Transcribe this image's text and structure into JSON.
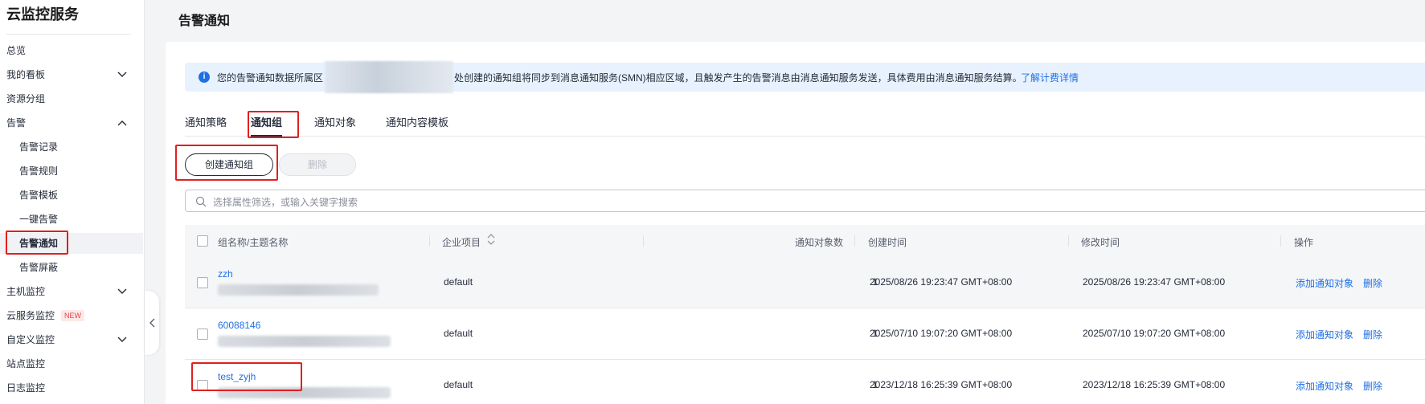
{
  "sidebar": {
    "title": "云监控服务",
    "items": [
      {
        "label": "总览",
        "level": 1,
        "chevron": ""
      },
      {
        "label": "我的看板",
        "level": 1,
        "chevron": "chevron-down-icon"
      },
      {
        "label": "资源分组",
        "level": 1,
        "chevron": ""
      },
      {
        "label": "告警",
        "level": 1,
        "chevron": "chevron-up-icon"
      },
      {
        "label": "告警记录",
        "level": 2,
        "chevron": ""
      },
      {
        "label": "告警规则",
        "level": 2,
        "chevron": ""
      },
      {
        "label": "告警模板",
        "level": 2,
        "chevron": ""
      },
      {
        "label": "一键告警",
        "level": 2,
        "chevron": ""
      },
      {
        "label": "告警通知",
        "level": 2,
        "chevron": "",
        "active": true
      },
      {
        "label": "告警屏蔽",
        "level": 2,
        "chevron": ""
      },
      {
        "label": "主机监控",
        "level": 1,
        "chevron": "chevron-down-icon"
      },
      {
        "label": "云服务监控",
        "level": 1,
        "chevron": "",
        "badge": "NEW"
      },
      {
        "label": "自定义监控",
        "level": 1,
        "chevron": "chevron-down-icon"
      },
      {
        "label": "站点监控",
        "level": 1,
        "chevron": ""
      },
      {
        "label": "日志监控",
        "level": 1,
        "chevron": ""
      }
    ]
  },
  "page": {
    "title": "告警通知"
  },
  "notice": {
    "text_before": "您的告警通知数据所属区",
    "text_after": "处创建的通知组将同步到消息通知服务(SMN)相应区域，且触发产生的告警消息由消息通知服务发送，具体费用由消息通知服务结算。",
    "link": "了解计费详情"
  },
  "tabs": [
    "通知策略",
    "通知组",
    "通知对象",
    "通知内容模板"
  ],
  "active_tab": "通知组",
  "toolbar": {
    "create_label": "创建通知组",
    "delete_label": "删除"
  },
  "search": {
    "placeholder": "选择属性筛选，或输入关键字搜索"
  },
  "table": {
    "columns": {
      "name": "组名称/主题名称",
      "project": "企业项目",
      "count": "通知对象数",
      "created": "创建时间",
      "modified": "修改时间",
      "ops": "操作"
    },
    "rows": [
      {
        "name": "zzh",
        "project": "default",
        "count": "1",
        "created": "2025/08/26 19:23:47 GMT+08:00",
        "modified": "2025/08/26 19:23:47 GMT+08:00",
        "op_add": "添加通知对象",
        "op_delete": "删除"
      },
      {
        "name": "60088146",
        "project": "default",
        "count": "1",
        "created": "2025/07/10 19:07:20 GMT+08:00",
        "modified": "2025/07/10 19:07:20 GMT+08:00",
        "op_add": "添加通知对象",
        "op_delete": "删除"
      },
      {
        "name": "test_zyjh",
        "project": "default",
        "count": "1",
        "created": "2023/12/18 16:25:39 GMT+08:00",
        "modified": "2023/12/18 16:25:39 GMT+08:00",
        "op_add": "添加通知对象",
        "op_delete": "删除"
      }
    ]
  },
  "colors": {
    "accent": "#1f6fe5",
    "highlight": "#e02020",
    "notice_bg": "#e8f2ff"
  }
}
